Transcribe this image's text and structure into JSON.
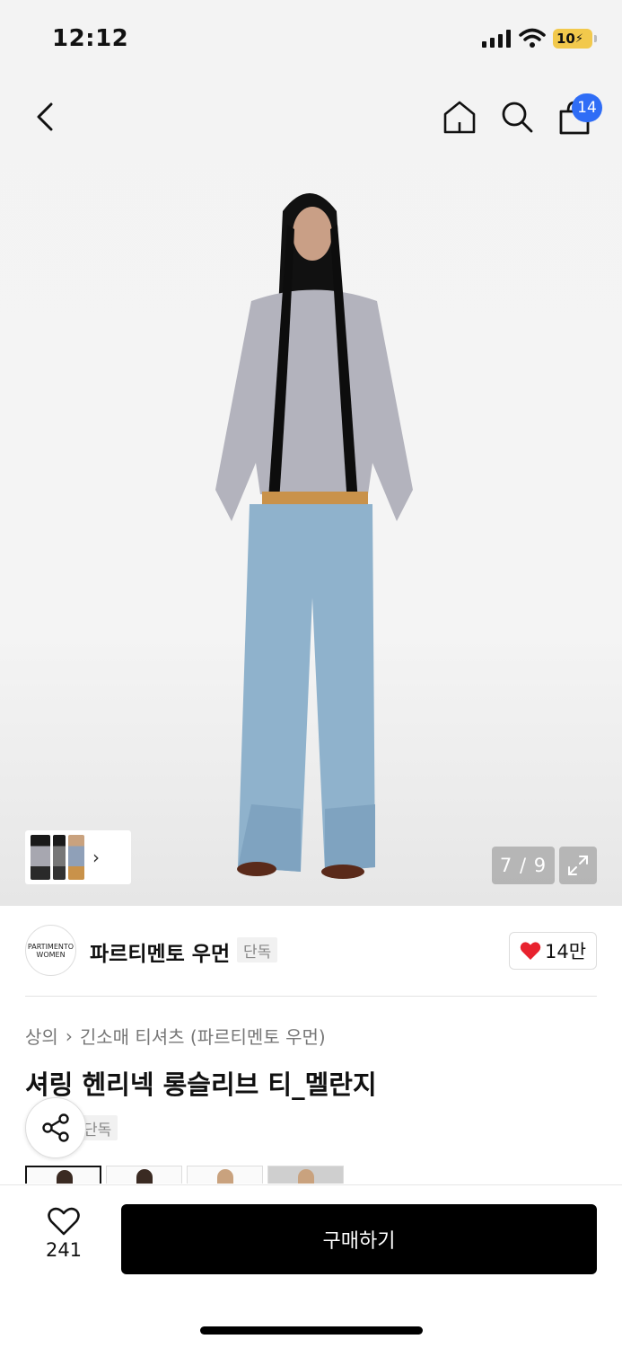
{
  "status_bar": {
    "time": "12:12",
    "battery": "10"
  },
  "header": {
    "cart_count": "14"
  },
  "gallery": {
    "counter": "7 / 9"
  },
  "brand": {
    "logo_line1": "PARTIMENTO",
    "logo_line2": "WOMEN",
    "name": "파르티멘토 우먼",
    "badge": "단독",
    "likes": "14만"
  },
  "breadcrumb": {
    "category": "상의",
    "subcategory": "긴소매 티셔츠 (파르티멘토 우먼)"
  },
  "product": {
    "title": "셔링 헨리넥 롱슬리브 티_멜란지",
    "badge": "단독"
  },
  "bottom": {
    "wish_count": "241",
    "buy_label": "구매하기"
  },
  "icons": [
    "back-icon",
    "home-icon",
    "search-icon",
    "cart-icon",
    "chevron-right-icon",
    "expand-icon",
    "heart-icon",
    "share-icon"
  ],
  "colors": {
    "accent_badge": "#2f6df6",
    "buy_button": "#000000",
    "heart": "#e8222e",
    "battery": "#f2c94c"
  }
}
